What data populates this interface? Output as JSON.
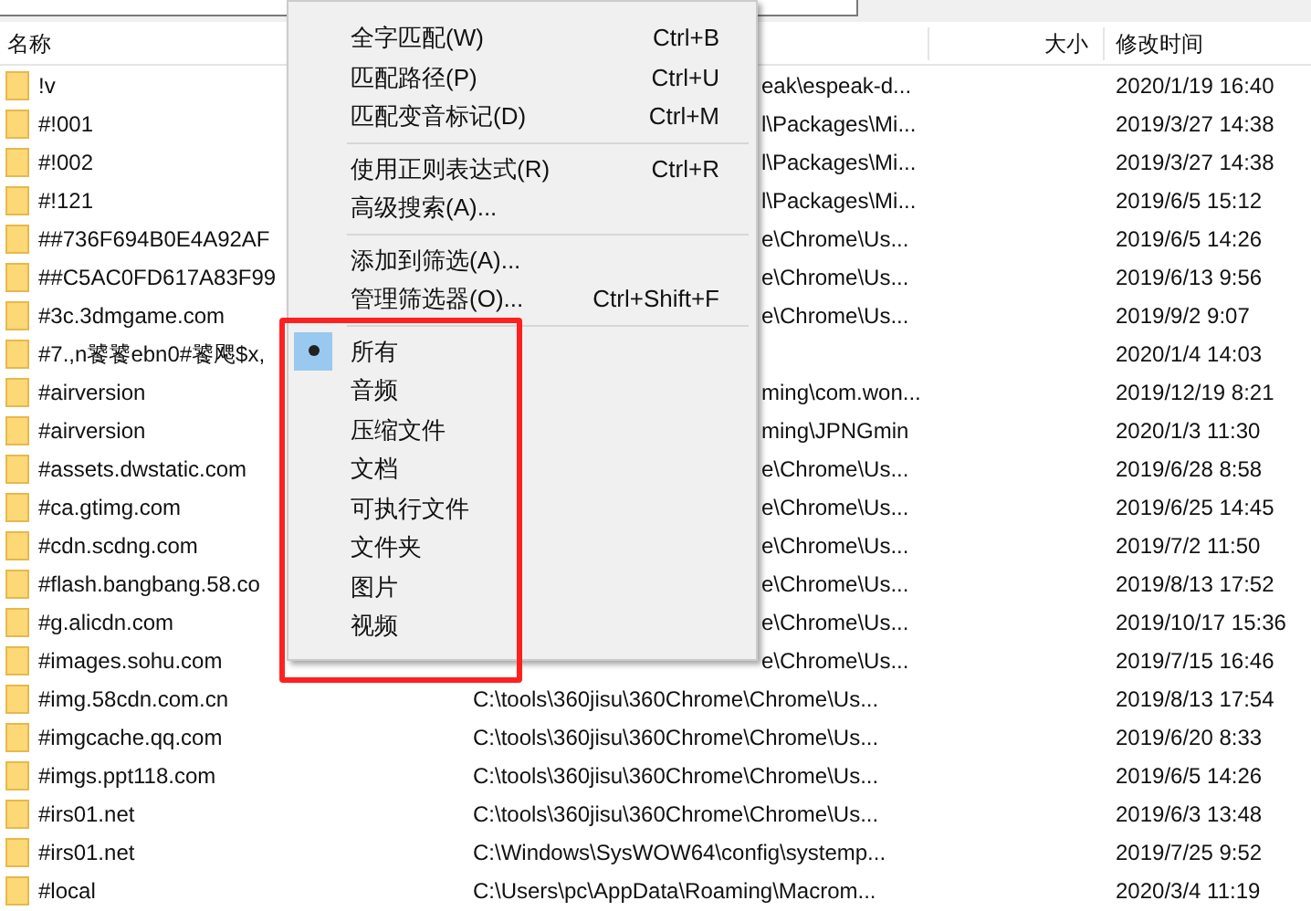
{
  "table": {
    "columns": [
      {
        "label": "名称"
      },
      {
        "label": "大小"
      },
      {
        "label": "修改时间"
      }
    ],
    "rows": [
      {
        "name": "!v",
        "path": "eak\\espeak-d...",
        "modified": "2020/1/19 16:40"
      },
      {
        "name": "#!001",
        "path": "l\\Packages\\Mi...",
        "modified": "2019/3/27 14:38"
      },
      {
        "name": "#!002",
        "path": "l\\Packages\\Mi...",
        "modified": "2019/3/27 14:38"
      },
      {
        "name": "#!121",
        "path": "l\\Packages\\Mi...",
        "modified": "2019/6/5 15:12"
      },
      {
        "name": "##736F694B0E4A92AF",
        "path": "e\\Chrome\\Us...",
        "modified": "2019/6/5 14:26"
      },
      {
        "name": "##C5AC0FD617A83F99",
        "path": "e\\Chrome\\Us...",
        "modified": "2019/6/13 9:56"
      },
      {
        "name": "#3c.3dmgame.com",
        "path": "e\\Chrome\\Us...",
        "modified": "2019/9/2 9:07"
      },
      {
        "name": "#7.,n饕饕ebn0#饕飔$x,",
        "path": "",
        "modified": "2020/1/4 14:03"
      },
      {
        "name": "#airversion",
        "path": "ming\\com.won...",
        "modified": "2019/12/19 8:21"
      },
      {
        "name": "#airversion",
        "path": "ming\\JPNGmin",
        "modified": "2020/1/3 11:30"
      },
      {
        "name": "#assets.dwstatic.com",
        "path": "e\\Chrome\\Us...",
        "modified": "2019/6/28 8:58"
      },
      {
        "name": "#ca.gtimg.com",
        "path": "e\\Chrome\\Us...",
        "modified": "2019/6/25 14:45"
      },
      {
        "name": "#cdn.scdng.com",
        "path": "e\\Chrome\\Us...",
        "modified": "2019/7/2 11:50"
      },
      {
        "name": "#flash.bangbang.58.co",
        "path": "e\\Chrome\\Us...",
        "modified": "2019/8/13 17:52"
      },
      {
        "name": "#g.alicdn.com",
        "path": "e\\Chrome\\Us...",
        "modified": "2019/10/17 15:36"
      },
      {
        "name": "#images.sohu.com",
        "path": "e\\Chrome\\Us...",
        "modified": "2019/7/15 16:46"
      },
      {
        "name": "#img.58cdn.com.cn",
        "path": "C:\\tools\\360jisu\\360Chrome\\Chrome\\Us...",
        "modified": "2019/8/13 17:54"
      },
      {
        "name": "#imgcache.qq.com",
        "path": "C:\\tools\\360jisu\\360Chrome\\Chrome\\Us...",
        "modified": "2019/6/20 8:33"
      },
      {
        "name": "#imgs.ppt118.com",
        "path": "C:\\tools\\360jisu\\360Chrome\\Chrome\\Us...",
        "modified": "2019/6/5 14:26"
      },
      {
        "name": "#irs01.net",
        "path": "C:\\tools\\360jisu\\360Chrome\\Chrome\\Us...",
        "modified": "2019/6/3 13:48"
      },
      {
        "name": "#irs01.net",
        "path": "C:\\Windows\\SysWOW64\\config\\systemp...",
        "modified": "2019/7/25 9:52"
      },
      {
        "name": "#local",
        "path": "C:\\Users\\pc\\AppData\\Roaming\\Macrom...",
        "modified": "2020/3/4 11:19"
      }
    ]
  },
  "context_menu": {
    "items": [
      {
        "kind": "item",
        "label": "全字匹配(W)",
        "shortcut": "Ctrl+B"
      },
      {
        "kind": "item",
        "label": "匹配路径(P)",
        "shortcut": "Ctrl+U"
      },
      {
        "kind": "item",
        "label": "匹配变音标记(D)",
        "shortcut": "Ctrl+M"
      },
      {
        "kind": "separator"
      },
      {
        "kind": "item",
        "label": "使用正则表达式(R)",
        "shortcut": "Ctrl+R"
      },
      {
        "kind": "item",
        "label": "高级搜索(A)..."
      },
      {
        "kind": "separator"
      },
      {
        "kind": "item",
        "label": "添加到筛选(A)..."
      },
      {
        "kind": "item",
        "label": "管理筛选器(O)...",
        "shortcut": "Ctrl+Shift+F"
      },
      {
        "kind": "separator"
      },
      {
        "kind": "radio",
        "label": "所有",
        "selected": true
      },
      {
        "kind": "radio",
        "label": "音频",
        "selected": false
      },
      {
        "kind": "radio",
        "label": "压缩文件",
        "selected": false
      },
      {
        "kind": "radio",
        "label": "文档",
        "selected": false
      },
      {
        "kind": "radio",
        "label": "可执行文件",
        "selected": false
      },
      {
        "kind": "radio",
        "label": "文件夹",
        "selected": false
      },
      {
        "kind": "radio",
        "label": "图片",
        "selected": false
      },
      {
        "kind": "radio",
        "label": "视频",
        "selected": false
      }
    ]
  }
}
